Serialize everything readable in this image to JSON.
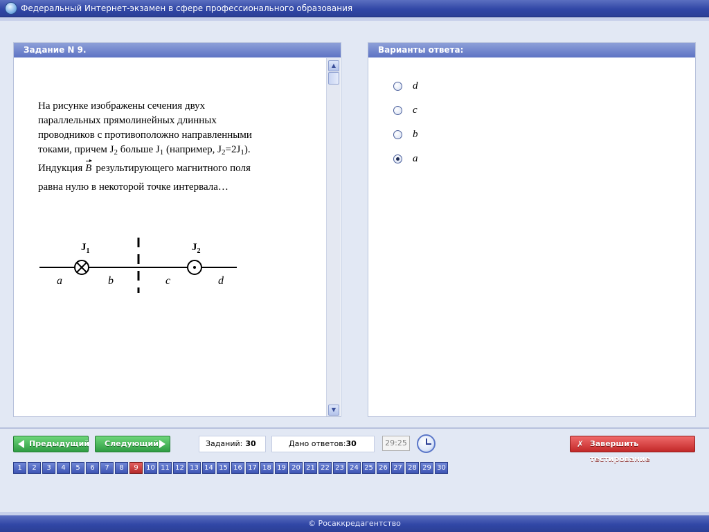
{
  "window": {
    "title": "Федеральный Интернет-экзамен в сфере профессионального образования",
    "icon": "globe-icon"
  },
  "task": {
    "header": "Задание N 9.",
    "question": {
      "l1": "На рисунке изображены сечения двух",
      "l2": "параллельных прямолинейных длинных",
      "l3": "проводников с противоположно направленными",
      "l4a": "токами, причем J",
      "l4b": "2",
      "l4c": " больше J",
      "l4d": "1",
      "l4e": " (например, J",
      "l4f": "2",
      "l4g": "=2J",
      "l4h": "1",
      "l4i": ").",
      "l5a": "Индукция",
      "l5b": "B",
      "l5c": "результирующего магнитного поля",
      "l6": "равна нулю в некоторой точке интервала…"
    },
    "figure": {
      "j1": "J",
      "j1_sub": "1",
      "j2": "J",
      "j2_sub": "2",
      "a": "a",
      "b": "b",
      "c": "c",
      "d": "d"
    }
  },
  "answers": {
    "header": "Варианты ответа:",
    "options": [
      {
        "label": "d",
        "selected": false
      },
      {
        "label": "c",
        "selected": false
      },
      {
        "label": "b",
        "selected": false
      },
      {
        "label": "a",
        "selected": true
      }
    ]
  },
  "toolbar": {
    "prev_label": "Предыдущий",
    "next_label": "Следующий",
    "tasks_label": "Заданий:",
    "tasks_count": "30",
    "answers_label": "Дано ответов:",
    "answers_count": "30",
    "timer": "29:25",
    "finish_label": "Завершить тестирование"
  },
  "pager": {
    "pages": [
      "1",
      "2",
      "3",
      "4",
      "5",
      "6",
      "7",
      "8",
      "9",
      "10",
      "11",
      "12",
      "13",
      "14",
      "15",
      "16",
      "17",
      "18",
      "19",
      "20",
      "21",
      "22",
      "23",
      "24",
      "25",
      "26",
      "27",
      "28",
      "29",
      "30"
    ],
    "current": "9"
  },
  "footer": {
    "copyright": "© Росаккредагентство"
  }
}
